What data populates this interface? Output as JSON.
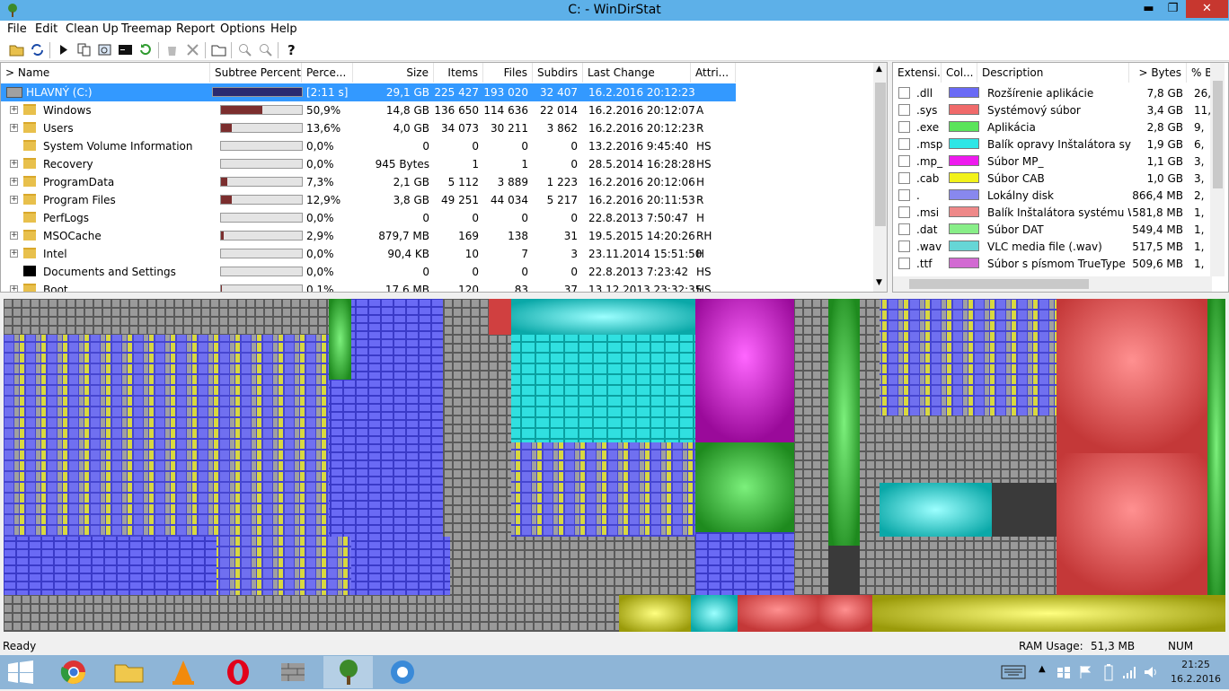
{
  "window": {
    "title": "C: - WinDirStat",
    "minimize": "▬",
    "maximize": "❐",
    "close": "✕"
  },
  "menu": [
    "File",
    "Edit",
    "Clean Up",
    "Treemap",
    "Report",
    "Options",
    "Help"
  ],
  "tree": {
    "headers": [
      "> Name",
      "Subtree Percent...",
      "Perce...",
      "Size",
      "Items",
      "Files",
      "Subdirs",
      "Last Change",
      "Attri..."
    ],
    "rows": [
      {
        "name": "HLAVNÝ (C:)",
        "fill": 1.0,
        "percent": "[2:11 s]",
        "size": "29,1 GB",
        "items": "225 427",
        "files": "193 020",
        "subdirs": "32 407",
        "last_change": "16.2.2016  20:12:23",
        "attr": ""
      },
      {
        "name": "Windows",
        "fill": 0.509,
        "percent": "50,9%",
        "size": "14,8 GB",
        "items": "136 650",
        "files": "114 636",
        "subdirs": "22 014",
        "last_change": "16.2.2016  20:12:07",
        "attr": "A"
      },
      {
        "name": "Users",
        "fill": 0.136,
        "percent": "13,6%",
        "size": "4,0 GB",
        "items": "34 073",
        "files": "30 211",
        "subdirs": "3 862",
        "last_change": "16.2.2016  20:12:23",
        "attr": "R"
      },
      {
        "name": "System Volume Information",
        "fill": 0.0,
        "percent": "0,0%",
        "size": "0",
        "items": "0",
        "files": "0",
        "subdirs": "0",
        "last_change": "13.2.2016  9:45:40",
        "attr": "HS"
      },
      {
        "name": "Recovery",
        "fill": 0.0,
        "percent": "0,0%",
        "size": "945 Bytes",
        "items": "1",
        "files": "1",
        "subdirs": "0",
        "last_change": "28.5.2014  16:28:28",
        "attr": "HS"
      },
      {
        "name": "ProgramData",
        "fill": 0.073,
        "percent": "7,3%",
        "size": "2,1 GB",
        "items": "5 112",
        "files": "3 889",
        "subdirs": "1 223",
        "last_change": "16.2.2016  20:12:06",
        "attr": "H"
      },
      {
        "name": "Program Files",
        "fill": 0.129,
        "percent": "12,9%",
        "size": "3,8 GB",
        "items": "49 251",
        "files": "44 034",
        "subdirs": "5 217",
        "last_change": "16.2.2016  20:11:53",
        "attr": "R"
      },
      {
        "name": "PerfLogs",
        "fill": 0.0,
        "percent": "0,0%",
        "size": "0",
        "items": "0",
        "files": "0",
        "subdirs": "0",
        "last_change": "22.8.2013  7:50:47",
        "attr": "H"
      },
      {
        "name": "MSOCache",
        "fill": 0.029,
        "percent": "2,9%",
        "size": "879,7 MB",
        "items": "169",
        "files": "138",
        "subdirs": "31",
        "last_change": "19.5.2015  14:20:26",
        "attr": "RH"
      },
      {
        "name": "Intel",
        "fill": 0.0,
        "percent": "0,0%",
        "size": "90,4 KB",
        "items": "10",
        "files": "7",
        "subdirs": "3",
        "last_change": "23.11.2014  15:51:50",
        "attr": "H"
      },
      {
        "name": "Documents and Settings",
        "fill": 0.0,
        "percent": "0,0%",
        "size": "0",
        "items": "0",
        "files": "0",
        "subdirs": "0",
        "last_change": "22.8.2013  7:23:42",
        "attr": "HS"
      },
      {
        "name": "Boot",
        "fill": 0.001,
        "percent": "0,1%",
        "size": "17,6 MB",
        "items": "120",
        "files": "83",
        "subdirs": "37",
        "last_change": "13.12.2013  23:32:35",
        "attr": "HS"
      }
    ]
  },
  "extensions": {
    "headers": [
      "Extensi...",
      "Col...",
      "Description",
      "> Bytes",
      "% B"
    ],
    "rows": [
      {
        "ext": ".dll",
        "color": "#6a6af5",
        "desc": "Rozšírenie aplikácie",
        "bytes": "7,8 GB",
        "pct": "26,"
      },
      {
        "ext": ".sys",
        "color": "#f06a6a",
        "desc": "Systémový súbor",
        "bytes": "3,4 GB",
        "pct": "11,"
      },
      {
        "ext": ".exe",
        "color": "#5ae45a",
        "desc": "Aplikácia",
        "bytes": "2,8 GB",
        "pct": "9,"
      },
      {
        "ext": ".msp",
        "color": "#2ee6e6",
        "desc": "Balík opravy Inštalátora syst...",
        "bytes": "1,9 GB",
        "pct": "6,"
      },
      {
        "ext": ".mp_",
        "color": "#ee1aee",
        "desc": "Súbor MP_",
        "bytes": "1,1 GB",
        "pct": "3,"
      },
      {
        "ext": ".cab",
        "color": "#f2f21a",
        "desc": "Súbor CAB",
        "bytes": "1,0 GB",
        "pct": "3,"
      },
      {
        "ext": ".",
        "color": "#8888ee",
        "desc": "Lokálny disk",
        "bytes": "866,4 MB",
        "pct": "2,"
      },
      {
        "ext": ".msi",
        "color": "#ee8888",
        "desc": "Balík Inštalátora systému Wi...",
        "bytes": "581,8 MB",
        "pct": "1,"
      },
      {
        "ext": ".dat",
        "color": "#88ee88",
        "desc": "Súbor DAT",
        "bytes": "549,4 MB",
        "pct": "1,"
      },
      {
        "ext": ".wav",
        "color": "#66d6d6",
        "desc": "VLC media file (.wav)",
        "bytes": "517,5 MB",
        "pct": "1,"
      },
      {
        "ext": ".ttf",
        "color": "#d26ad2",
        "desc": "Súbor s písmom TrueType",
        "bytes": "509,6 MB",
        "pct": "1,"
      }
    ]
  },
  "status": {
    "left": "Ready",
    "ram_label": "RAM Usage:",
    "ram_value": "51,3 MB",
    "num": "NUM"
  },
  "clock": {
    "time": "21:25",
    "date": "16.2.2016"
  }
}
